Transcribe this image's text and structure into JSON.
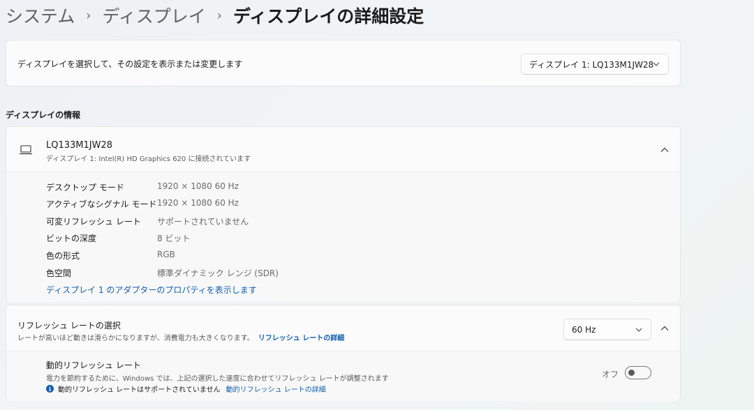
{
  "breadcrumb": {
    "items": [
      "システム",
      "ディスプレイ",
      "ディスプレイの詳細設定"
    ],
    "separator": "›"
  },
  "select_display": {
    "label": "ディスプレイを選択して、その設定を表示または変更します",
    "selected": "ディスプレイ 1: LQ133M1JW28"
  },
  "section_heading": "ディスプレイの情報",
  "display_info": {
    "name": "LQ133M1JW28",
    "subtitle": "ディスプレイ 1: Intel(R) HD Graphics 620 に接続されています",
    "rows": [
      {
        "label": "デスクトップ モード",
        "value": "1920 × 1080 60 Hz"
      },
      {
        "label": "アクティブなシグナル モード",
        "value": "1920 × 1080 60 Hz"
      },
      {
        "label": "可変リフレッシュ レート",
        "value": "サポートされていません"
      },
      {
        "label": "ビットの深度",
        "value": "8 ビット"
      },
      {
        "label": "色の形式",
        "value": "RGB"
      },
      {
        "label": "色空間",
        "value": "標準ダイナミック レンジ (SDR)"
      }
    ],
    "adapter_link": "ディスプレイ 1 のアダプターのプロパティを表示します"
  },
  "refresh_rate": {
    "title": "リフレッシュ レートの選択",
    "description": "レートが高いほど動きは滑らかになりますが、消費電力も大きくなります。",
    "link": "リフレッシュ レートの詳細",
    "selected": "60 Hz"
  },
  "dynamic_refresh": {
    "title": "動的リフレッシュ レート",
    "description": "電力を節約するために、Windows では、上記の選択した速度に合わせてリフレッシュ レートが調整されます",
    "note": "動的リフレッシュ レートはサポートされていません",
    "note_link": "動的リフレッシュ レートの詳細",
    "toggle_label": "オフ",
    "toggle_on": false
  },
  "colors": {
    "accent": "#0f5fae",
    "card_bg": "#fbfbfb"
  },
  "icons": [
    "chevron-right-icon",
    "chevron-down-icon",
    "chevron-up-icon",
    "laptop-icon",
    "info-icon"
  ]
}
